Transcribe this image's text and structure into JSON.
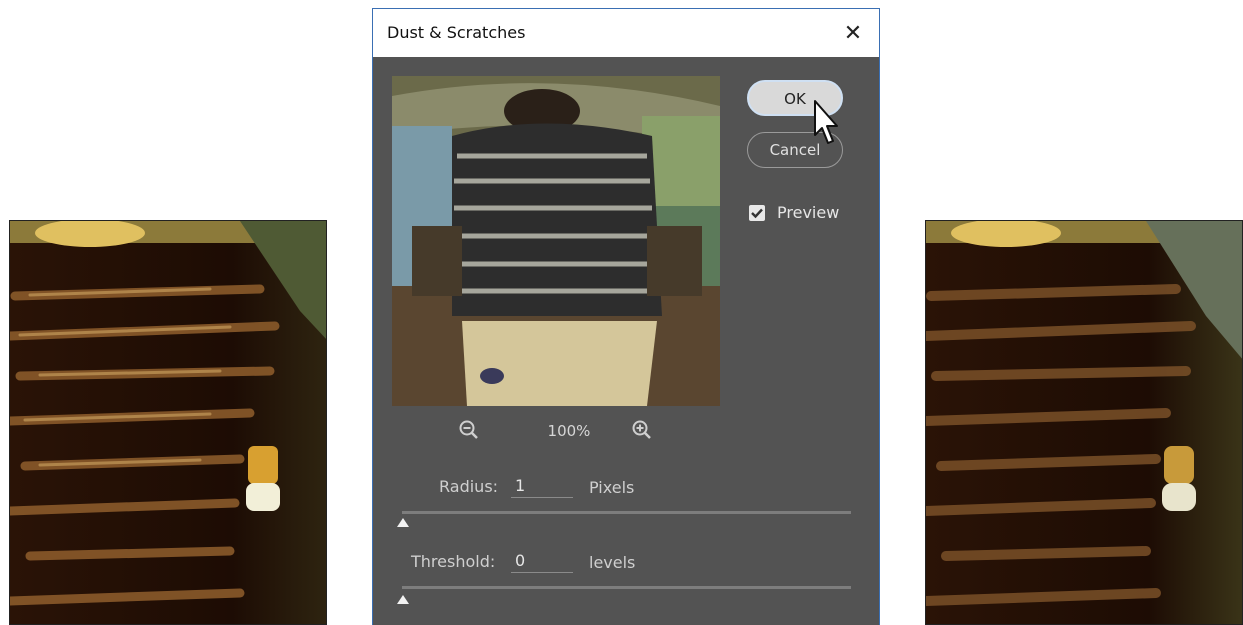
{
  "dialog": {
    "title": "Dust & Scratches",
    "ok_label": "OK",
    "cancel_label": "Cancel",
    "preview_label": "Preview",
    "preview_checked": true,
    "zoom_level": "100%",
    "radius": {
      "label": "Radius:",
      "value": "1",
      "unit": "Pixels"
    },
    "threshold": {
      "label": "Threshold:",
      "value": "0",
      "unit": "levels"
    }
  },
  "icons": {
    "close": "close-icon",
    "zoom_out": "zoom-out-icon",
    "zoom_in": "zoom-in-icon",
    "cursor": "mouse-cursor-icon",
    "checkbox": "checkmark-icon"
  },
  "colors": {
    "dialog_bg": "#535353",
    "title_bg": "#ffffff",
    "border_accent": "#3a6fb3",
    "ok_button": "#d9d9d9"
  }
}
